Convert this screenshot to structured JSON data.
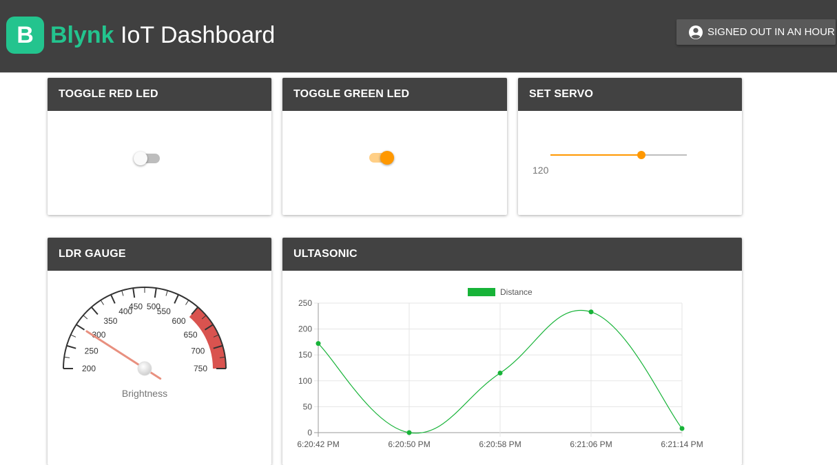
{
  "header": {
    "logo_letter": "B",
    "brand_name": "Blynk",
    "title": "IoT Dashboard",
    "signout_label": "SIGNED OUT IN AN HOUR",
    "signout_icon": "account-circle-icon"
  },
  "cards": {
    "red_led": {
      "title": "TOGGLE RED LED",
      "on": false
    },
    "green_led": {
      "title": "TOGGLE GREEN LED",
      "on": true
    },
    "servo": {
      "title": "SET SERVO",
      "value": "120",
      "min": 0,
      "max": 180
    },
    "ldr": {
      "title": "LDR GAUGE",
      "label": "Brightness",
      "value": 300,
      "min": 200,
      "max": 750,
      "red_from": 600,
      "ticks": [
        "200",
        "250",
        "300",
        "350",
        "400",
        "450",
        "500",
        "550",
        "600",
        "650",
        "700",
        "750"
      ]
    },
    "ultrasonic": {
      "title": "ULTASONIC"
    }
  },
  "colors": {
    "brand": "#23c48e",
    "header_bg": "#404040",
    "card_head_bg": "#424242",
    "accent": "#ff9800",
    "line": "#17b338",
    "gauge_red": "#d9534f"
  },
  "chart_data": {
    "type": "line",
    "legend": "top",
    "grid": true,
    "x": [
      "6:20:42 PM",
      "6:20:50 PM",
      "6:20:58 PM",
      "6:21:06 PM",
      "6:21:14 PM"
    ],
    "series": [
      {
        "name": "Distance",
        "values": [
          172,
          0,
          115,
          233,
          8
        ]
      }
    ],
    "ylim": [
      0,
      250
    ],
    "yticks": [
      "0",
      "50",
      "100",
      "150",
      "200",
      "250"
    ]
  }
}
